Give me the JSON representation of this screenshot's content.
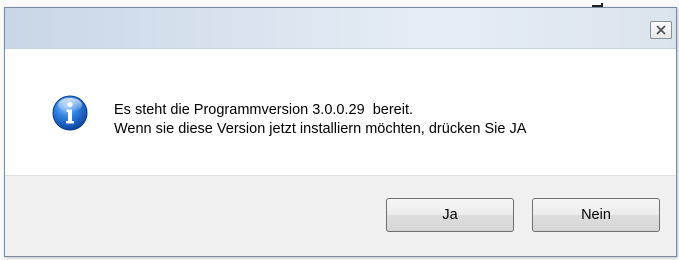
{
  "dialog": {
    "title": "",
    "close_icon": "close-icon",
    "message_icon": "info-icon",
    "message_line1": "Es steht die Programmversion 3.0.0.29  bereit.",
    "message_line2": "Wenn sie diese Version jetzt installiern möchten, drücken Sie JA",
    "buttons": {
      "yes_label": "Ja",
      "no_label": "Nein"
    }
  },
  "colors": {
    "titlebar": "#d9e3ef",
    "footer": "#f0f0f0",
    "info_blue": "#1f63c7"
  }
}
